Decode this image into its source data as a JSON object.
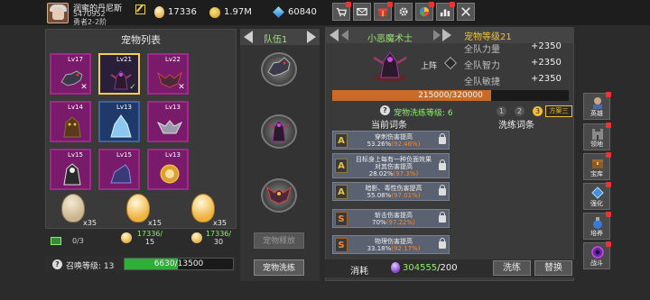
{
  "player": {
    "name": "润蜜的丹尼斯",
    "id": "5470952",
    "rank": "勇者2-2阶"
  },
  "resources": {
    "eggs": "17336",
    "gold": "1.97M",
    "gems": "60840"
  },
  "menu_buttons": [
    "shop",
    "mail",
    "gift",
    "settings",
    "roulette",
    "rank",
    "battle"
  ],
  "pet_list": {
    "title": "宠物列表",
    "pets": [
      {
        "level": "Lv17",
        "mark": "x"
      },
      {
        "level": "Lv21",
        "mark": "check",
        "selected": true
      },
      {
        "level": "Lv22",
        "mark": "x"
      },
      {
        "level": "Lv14",
        "mark": ""
      },
      {
        "level": "Lv13",
        "mark": ""
      },
      {
        "level": "Lv13",
        "mark": ""
      },
      {
        "level": "Lv15",
        "mark": ""
      },
      {
        "level": "Lv15",
        "mark": ""
      },
      {
        "level": "Lv13",
        "mark": ""
      }
    ]
  },
  "eggs": [
    {
      "count": "x35",
      "caption": "0/3"
    },
    {
      "count": "x15",
      "caption_top": "17336/",
      "caption_bottom": "15"
    },
    {
      "count": "x35",
      "caption_top": "17336/",
      "caption_bottom": "30"
    }
  ],
  "summon": {
    "label": "召唤等级:",
    "level": "13",
    "progress_text": "6630/13500",
    "progress": 0.491
  },
  "team": {
    "label": "队伍1",
    "release_btn": "宠物释放",
    "wash_btn": "宠物洗练"
  },
  "detail": {
    "pet_name": "小恶魔术士",
    "on_label": "上阵",
    "level_label": "宠物等级21",
    "stats": [
      {
        "name": "全队力量",
        "value": "+2350"
      },
      {
        "name": "全队智力",
        "value": "+2350"
      },
      {
        "name": "全队敏捷",
        "value": "+2350"
      }
    ],
    "exp_text": "215000/320000",
    "exp": 0.672,
    "wash_level_label": "宠物洗练等级: 6",
    "wash_levels": [
      "1",
      "2",
      "3"
    ],
    "plan_label": "方案三",
    "col_current": "当前词条",
    "col_wash": "洗练词条",
    "entries": [
      {
        "icon": "A",
        "line1": "穿刺伤害提高",
        "line2a": "53.26%",
        "line2b": "(92.46%)"
      },
      {
        "icon": "A",
        "line1": "目标身上每有一种负面效果",
        "line1b": "对其伤害提高",
        "line2a": "28.02%",
        "line2b": "(97.3%)"
      },
      {
        "icon": "A",
        "line1": "暗影、毒性伤害提高",
        "line2a": "55.08%",
        "line2b": "(97.01%)"
      },
      {
        "icon": "S",
        "line1": "斩击伤害提高",
        "line2a": "70%",
        "line2b": "(97.22%)"
      },
      {
        "icon": "S",
        "line1": "物理伤害提高",
        "line2a": "33.18%",
        "line2b": "(92.17%)"
      }
    ],
    "cost_label": "消耗",
    "cost_have": "304555",
    "cost_need": "/200",
    "wash_action": "洗练",
    "replace_action": "替换"
  },
  "side_tabs": [
    "英雄",
    "领地",
    "宝库",
    "强化",
    "培养",
    "战斗"
  ],
  "colors": {
    "accent_gold": "#f2c032",
    "green_text": "#8ef06a",
    "exp_bar": "#c96a28",
    "summon_bar": "#2fae3a",
    "pet_card": "#7a1a6a"
  }
}
